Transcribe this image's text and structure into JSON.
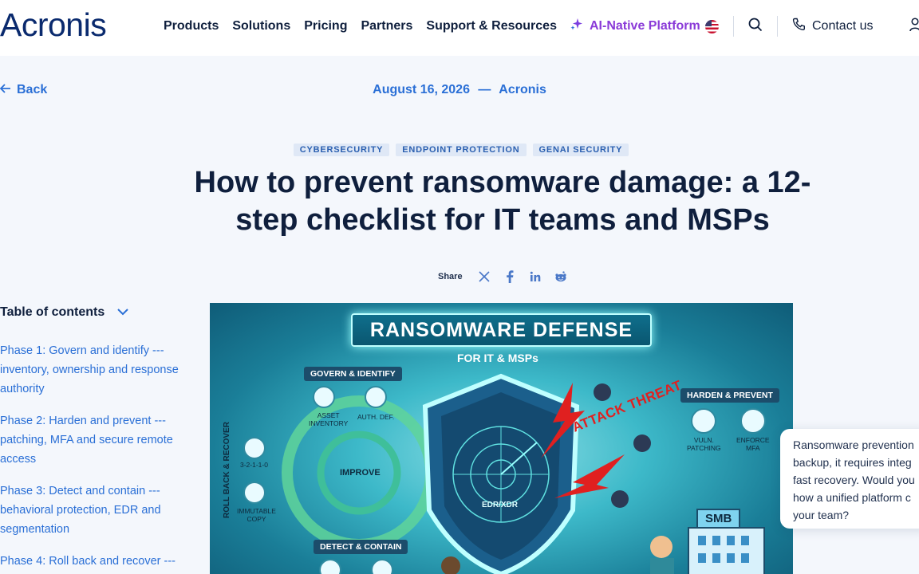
{
  "header": {
    "logo": "Acronis",
    "nav": [
      "Products",
      "Solutions",
      "Pricing",
      "Partners",
      "Support & Resources"
    ],
    "ai_platform": "AI-Native Platform",
    "contact": "Contact us"
  },
  "meta": {
    "back": "Back",
    "date": "August 16, 2026",
    "dash": "—",
    "author": "Acronis"
  },
  "tags": [
    "CYBERSECURITY",
    "ENDPOINT PROTECTION",
    "GENAI SECURITY"
  ],
  "article": {
    "title_line1": "How to prevent ransomware damage: a 12-",
    "title_line2": "step checklist for IT teams and MSPs"
  },
  "share": {
    "label": "Share"
  },
  "toc": {
    "heading": "Table of contents",
    "items": [
      [
        "Phase 1: Govern and identify ---",
        "inventory, ownership and response",
        "authority"
      ],
      [
        "Phase 2: Harden and prevent ---",
        "patching, MFA and secure remote",
        "access"
      ],
      [
        "Phase 3: Detect and contain ---",
        "behavioral protection, EDR and",
        "segmentation"
      ],
      [
        "Phase 4: Roll back and recover ---"
      ]
    ]
  },
  "hero": {
    "banner": "RANSOMWARE DEFENSE",
    "sub": "FOR IT & MSPs",
    "govern": "GOVERN & IDENTIFY",
    "asset": "ASSET\nINVENTORY",
    "auth": "AUTH. DEF.",
    "improve": "IMPROVE",
    "detect": "DETECT & CONTAIN",
    "roll": "ROLL BACK & RECOVER",
    "backup": "3-2-1-1-0",
    "immutable": "IMMUTABLE\nCOPY",
    "harden": "HARDEN & PREVENT",
    "vuln": "VULN.\nPATCHING",
    "mfa": "ENFORCE\nMFA",
    "threat": "ATTACK THREAT",
    "edr": "EDR/XDR",
    "smb": "SMB"
  },
  "chat": {
    "lines": [
      "Ransomware prevention",
      "backup, it requires integ",
      "fast recovery. Would you",
      "how a unified platform c",
      "your team?"
    ]
  }
}
